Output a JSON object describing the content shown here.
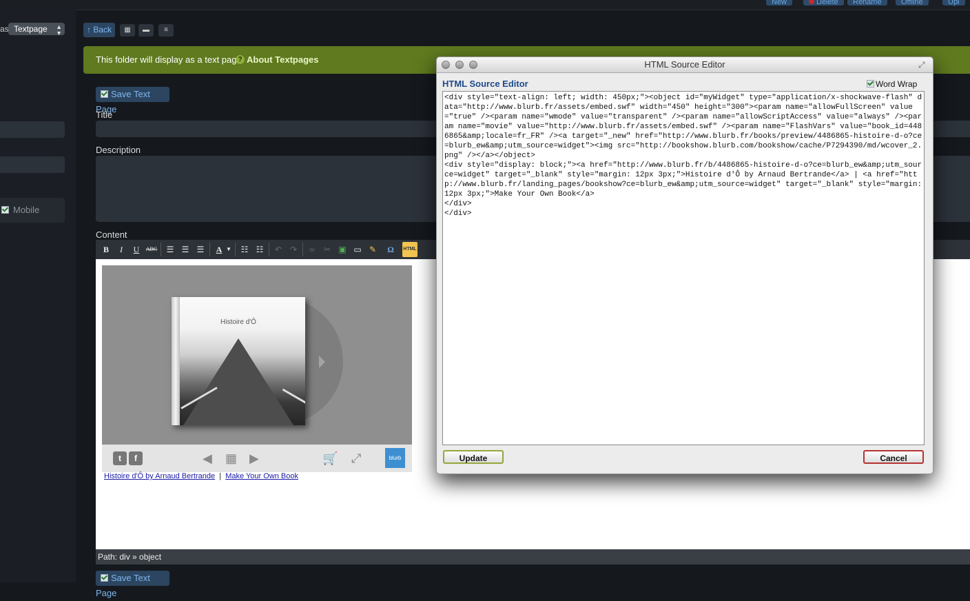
{
  "topbar": {
    "buttons": [
      {
        "label": "New"
      },
      {
        "label": "Delete"
      },
      {
        "label": "Rename"
      },
      {
        "label": "Offline"
      },
      {
        "label": "Upl"
      }
    ]
  },
  "sidebar": {
    "as_label": "as",
    "type_select": "Textpage",
    "mobile_label": "Mobile"
  },
  "toolbar": {
    "back_label": "Back"
  },
  "banner": {
    "text": "This folder will display as a text page.",
    "help": "?",
    "link": "About Textpages"
  },
  "form": {
    "save_label": "Save Text Page",
    "title_label": "Title",
    "description_label": "Description",
    "content_label": "Content"
  },
  "editor": {
    "buttons": {
      "bold": "B",
      "italic": "I",
      "underline": "U",
      "strike": "ABC",
      "font_color": "A",
      "html": "HTML"
    },
    "path": "Path: div » object"
  },
  "widget": {
    "book_title": "Histoire d'Ô",
    "brand": "blurb",
    "twitter": "t",
    "facebook": "f",
    "link1": "Histoire d'Ô by Arnaud Bertrande",
    "separator": "|",
    "link2": "Make Your Own Book"
  },
  "dialog": {
    "title": "HTML Source Editor",
    "heading": "HTML Source Editor",
    "word_wrap": "Word Wrap",
    "source": "<div style=\"text-align: left; width: 450px;\"><object id=\"myWidget\" type=\"application/x-shockwave-flash\" data=\"http://www.blurb.fr/assets/embed.swf\" width=\"450\" height=\"300\"><param name=\"allowFullScreen\" value=\"true\" /><param name=\"wmode\" value=\"transparent\" /><param name=\"allowScriptAccess\" value=\"always\" /><param name=\"movie\" value=\"http://www.blurb.fr/assets/embed.swf\" /><param name=\"FlashVars\" value=\"book_id=4486865&amp;locale=fr_FR\" /><a target=\"_new\" href=\"http://www.blurb.fr/books/preview/4486865-histoire-d-o?ce=blurb_ew&amp;utm_source=widget\"><img src=\"http://bookshow.blurb.com/bookshow/cache/P7294390/md/wcover_2.png\" /></a></object>\n<div style=\"display: block;\"><a href=\"http://www.blurb.fr/b/4486865-histoire-d-o?ce=blurb_ew&amp;utm_source=widget\" target=\"_blank\" style=\"margin: 12px 3px;\">Histoire d'Ô by Arnaud Bertrande</a> | <a href=\"http://www.blurb.fr/landing_pages/bookshow?ce=blurb_ew&amp;utm_source=widget\" target=\"_blank\" style=\"margin: 12px 3px;\">Make Your Own Book</a>\n</div>\n</div>",
    "update_label": "Update",
    "cancel_label": "Cancel"
  }
}
